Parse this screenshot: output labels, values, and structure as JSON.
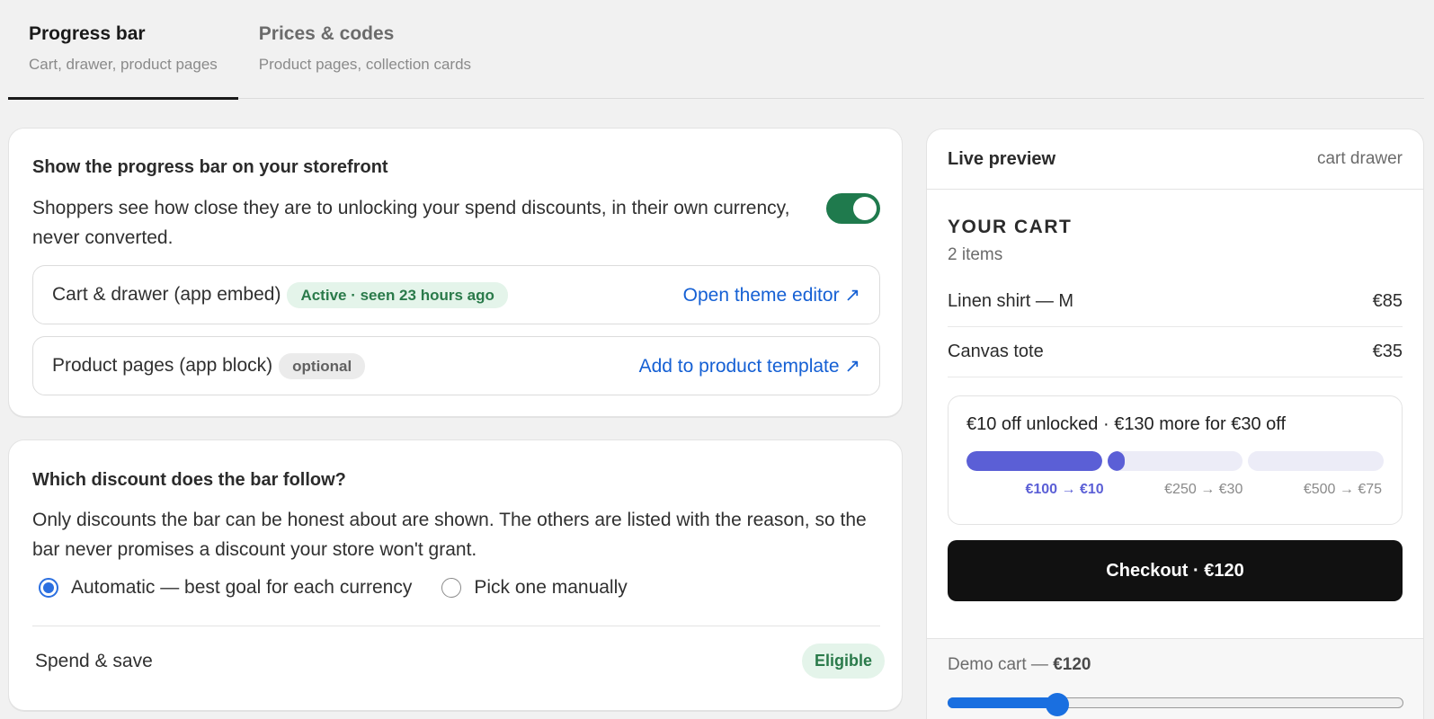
{
  "tabs": [
    {
      "title": "Progress bar",
      "subtitle": "Cart, drawer, product pages",
      "active": true
    },
    {
      "title": "Prices & codes",
      "subtitle": "Product pages, collection cards",
      "active": false
    }
  ],
  "storefront_card": {
    "heading": "Show the progress bar on your storefront",
    "description": "Shoppers see how close they are to unlocking your spend discounts, in their own currency, never converted.",
    "toggle_on": true,
    "rows": [
      {
        "label": "Cart & drawer (app embed)",
        "badge": "Active · seen 23 hours ago",
        "link": "Open theme editor ↗"
      },
      {
        "label": "Product pages (app block)",
        "badge": "optional",
        "link": "Add to product template ↗"
      }
    ]
  },
  "discount_card": {
    "heading": "Which discount does the bar follow?",
    "description": "Only discounts the bar can be honest about are shown. The others are listed with the reason, so the bar never promises a discount your store won't grant.",
    "options": [
      {
        "label": "Automatic — best goal for each currency",
        "checked": true
      },
      {
        "label": "Pick one manually",
        "checked": false
      }
    ],
    "discount_row": {
      "label": "Spend & save",
      "badge": "Eligible"
    }
  },
  "preview": {
    "title": "Live preview",
    "context": "cart drawer",
    "cart_title": "YOUR CART",
    "item_count": "2 items",
    "items": [
      {
        "name": "Linen shirt — M",
        "price": "€85"
      },
      {
        "name": "Canvas tote",
        "price": "€35"
      }
    ],
    "progress": {
      "message": "€10 off unlocked · €130 more for €30 off",
      "tiers": [
        {
          "label": "€100 → €10",
          "fill_fraction": 1.0,
          "reached": true
        },
        {
          "label": "€250 → €30",
          "fill_fraction": 0.13,
          "reached": false
        },
        {
          "label": "€500 → €75",
          "fill_fraction": 0.0,
          "reached": false
        }
      ],
      "accent_color": "#5b5fd6"
    },
    "checkout_label": "Checkout · €120",
    "demo": {
      "label_prefix": "Demo cart — ",
      "value_label": "€120",
      "slider_fraction": 0.24
    }
  }
}
